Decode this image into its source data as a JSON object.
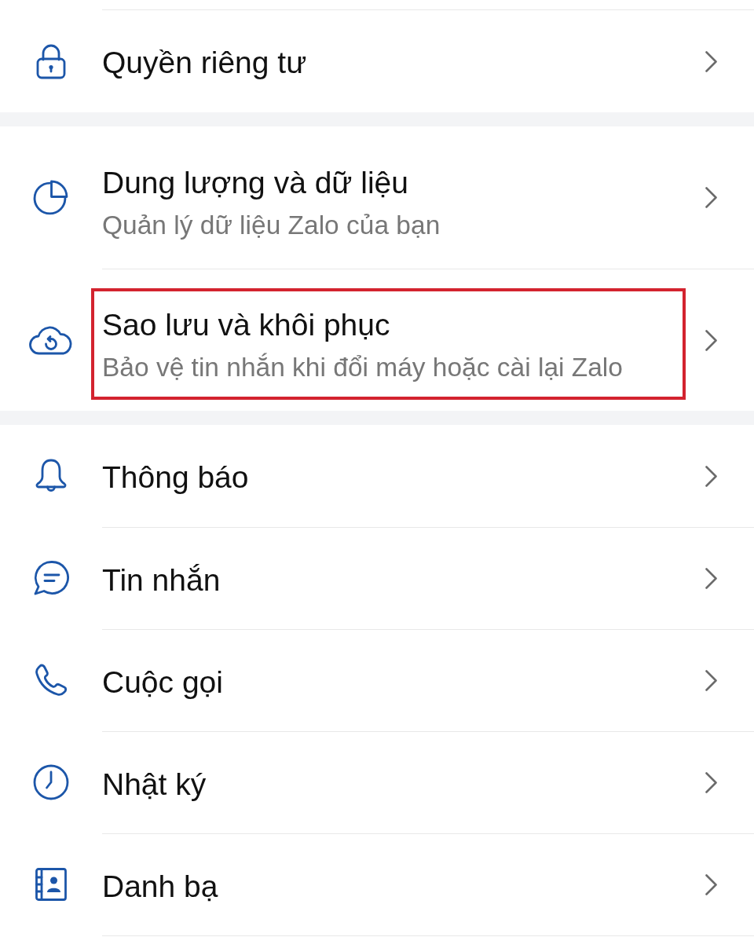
{
  "settings_list": {
    "sections": [
      {
        "items": [
          {
            "title": "Quyền riêng tư",
            "highlighted": false
          }
        ]
      },
      {
        "items": [
          {
            "title": "Dung lượng và dữ liệu",
            "subtitle": "Quản lý dữ liệu Zalo của bạn",
            "highlighted": false
          },
          {
            "title": "Sao lưu và khôi phục",
            "subtitle": "Bảo vệ tin nhắn khi đổi máy hoặc cài lại Zalo",
            "highlighted": true
          }
        ]
      },
      {
        "items": [
          {
            "title": "Thông báo",
            "highlighted": false
          },
          {
            "title": "Tin nhắn",
            "highlighted": false
          },
          {
            "title": "Cuộc gọi",
            "highlighted": false
          },
          {
            "title": "Nhật ký",
            "highlighted": false
          },
          {
            "title": "Danh bạ",
            "highlighted": false
          }
        ]
      }
    ]
  }
}
